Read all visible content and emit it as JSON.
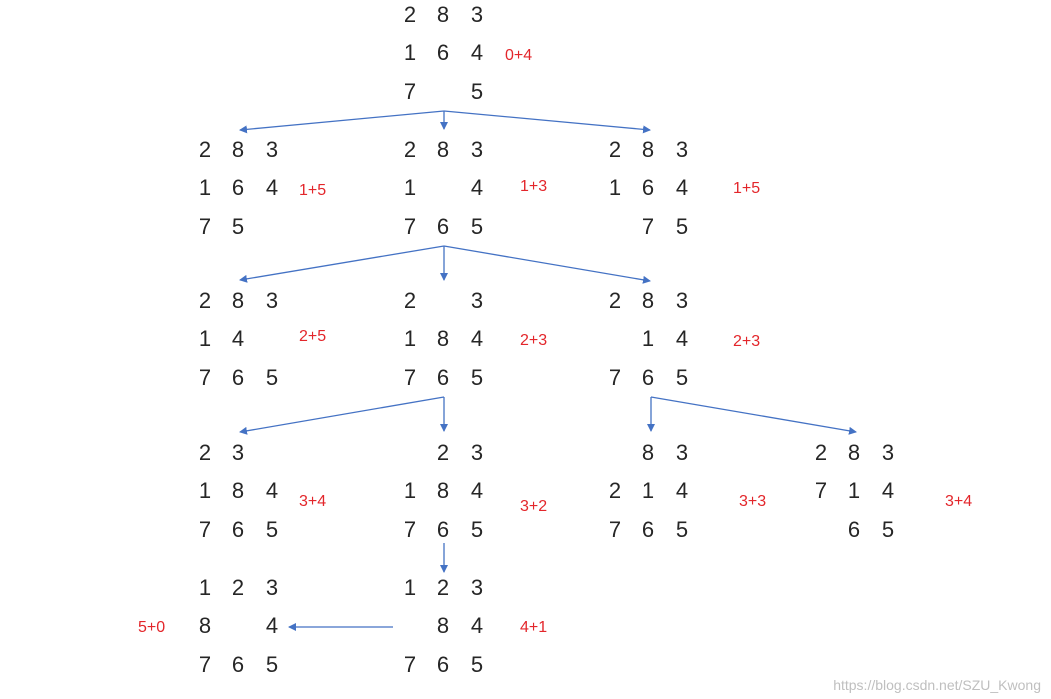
{
  "accent_color": "#4472c4",
  "cost_color": "#e3262b",
  "nodes": [
    {
      "id": "n0",
      "grid": [
        [
          "2",
          "8",
          "3"
        ],
        [
          "1",
          "6",
          "4"
        ],
        [
          "7",
          "",
          "5"
        ]
      ],
      "cost": "0+4"
    },
    {
      "id": "n1a",
      "grid": [
        [
          "2",
          "8",
          "3"
        ],
        [
          "1",
          "6",
          "4"
        ],
        [
          "7",
          "5",
          ""
        ]
      ],
      "cost": "1+5"
    },
    {
      "id": "n1b",
      "grid": [
        [
          "2",
          "8",
          "3"
        ],
        [
          "1",
          "",
          "4"
        ],
        [
          "7",
          "6",
          "5"
        ]
      ],
      "cost": "1+3"
    },
    {
      "id": "n1c",
      "grid": [
        [
          "2",
          "8",
          "3"
        ],
        [
          "1",
          "6",
          "4"
        ],
        [
          "",
          "7",
          "5"
        ]
      ],
      "cost": "1+5"
    },
    {
      "id": "n2a",
      "grid": [
        [
          "2",
          "8",
          "3"
        ],
        [
          "1",
          "4",
          ""
        ],
        [
          "7",
          "6",
          "5"
        ]
      ],
      "cost": "2+5"
    },
    {
      "id": "n2b",
      "grid": [
        [
          "2",
          "",
          "3"
        ],
        [
          "1",
          "8",
          "4"
        ],
        [
          "7",
          "6",
          "5"
        ]
      ],
      "cost": "2+3"
    },
    {
      "id": "n2c",
      "grid": [
        [
          "2",
          "8",
          "3"
        ],
        [
          "",
          "1",
          "4"
        ],
        [
          "7",
          "6",
          "5"
        ]
      ],
      "cost": "2+3"
    },
    {
      "id": "n3a",
      "grid": [
        [
          "2",
          "3",
          ""
        ],
        [
          "1",
          "8",
          "4"
        ],
        [
          "7",
          "6",
          "5"
        ]
      ],
      "cost": "3+4"
    },
    {
      "id": "n3b",
      "grid": [
        [
          "",
          "2",
          "3"
        ],
        [
          "1",
          "8",
          "4"
        ],
        [
          "7",
          "6",
          "5"
        ]
      ],
      "cost": "3+2"
    },
    {
      "id": "n3c",
      "grid": [
        [
          "",
          "8",
          "3"
        ],
        [
          "2",
          "1",
          "4"
        ],
        [
          "7",
          "6",
          "5"
        ]
      ],
      "cost": "3+3"
    },
    {
      "id": "n3d",
      "grid": [
        [
          "2",
          "8",
          "3"
        ],
        [
          "7",
          "1",
          "4"
        ],
        [
          "",
          "6",
          "5"
        ]
      ],
      "cost": "3+4"
    },
    {
      "id": "n4a",
      "grid": [
        [
          "1",
          "2",
          "3"
        ],
        [
          "8",
          "",
          "4"
        ],
        [
          "7",
          "6",
          "5"
        ]
      ],
      "cost": "5+0"
    },
    {
      "id": "n4b",
      "grid": [
        [
          "1",
          "2",
          "3"
        ],
        [
          "",
          "8",
          "4"
        ],
        [
          "7",
          "6",
          "5"
        ]
      ],
      "cost": "4+1"
    }
  ],
  "edges": [
    [
      "n0",
      "n1a"
    ],
    [
      "n0",
      "n1b"
    ],
    [
      "n0",
      "n1c"
    ],
    [
      "n1b",
      "n2a"
    ],
    [
      "n1b",
      "n2b"
    ],
    [
      "n1b",
      "n2c"
    ],
    [
      "n2b",
      "n3a"
    ],
    [
      "n2b",
      "n3b"
    ],
    [
      "n2c",
      "n3c"
    ],
    [
      "n2c",
      "n3d"
    ],
    [
      "n3b",
      "n4b"
    ],
    [
      "n4b",
      "n4a"
    ]
  ],
  "watermark": "https://blog.csdn.net/SZU_Kwong"
}
